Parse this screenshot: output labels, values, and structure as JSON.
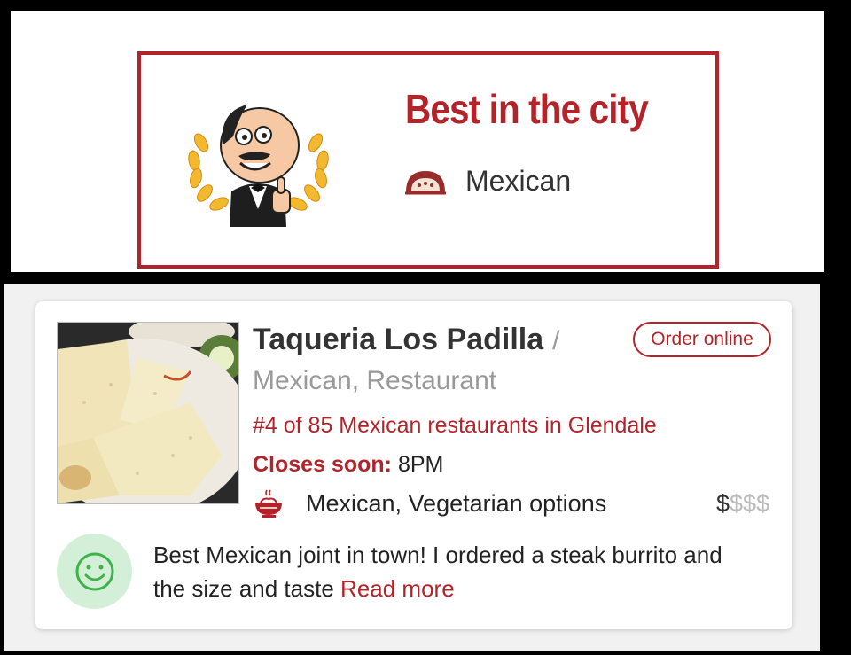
{
  "award": {
    "title": "Best in the city",
    "cuisine": "Mexican",
    "icons": [
      "chef-laurel-emblem",
      "taco-icon"
    ],
    "accent_color": "#b3242a"
  },
  "listing": {
    "name": "Taqueria Los Padilla",
    "separator": "/",
    "order_button": "Order online",
    "categories": "Mexican, Restaurant",
    "ranking": "#4 of 85 Mexican restaurants in Glendale",
    "closes_label": "Closes soon:",
    "closes_time": "8PM",
    "cuisine_tags": "Mexican, Vegetarian options",
    "price": {
      "active": "$",
      "inactive": "$$$",
      "level": 1,
      "max": 4
    },
    "review": {
      "text": "Best Mexican joint in town! I ordered a steak burrito and the size and taste",
      "read_more": "Read more"
    },
    "icons": [
      "food-photo",
      "dish-icon",
      "smiley-icon"
    ]
  }
}
